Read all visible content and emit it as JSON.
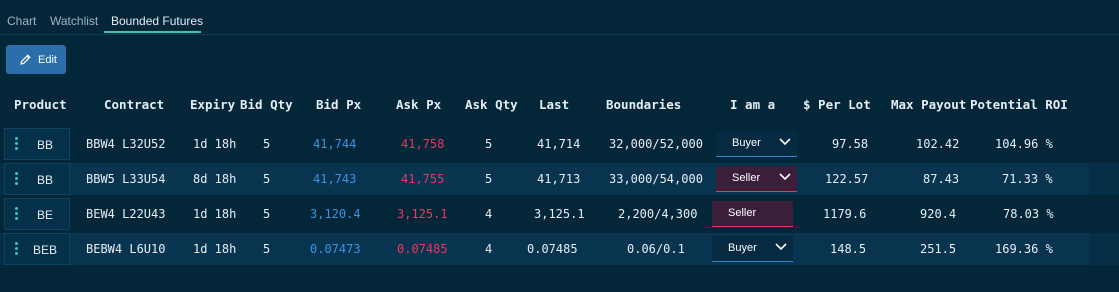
{
  "tabs": [
    {
      "label": "Chart"
    },
    {
      "label": "Watchlist"
    },
    {
      "label": "Bounded Futures"
    }
  ],
  "toolbar": {
    "edit_label": "Edit"
  },
  "columns": [
    "Product",
    "Contract",
    "Expiry",
    "Bid Qty",
    "Bid Px",
    "Ask Px",
    "Ask Qty",
    "Last",
    "Boundaries",
    "I am a",
    "$ Per Lot",
    "Max Payout",
    "Potential ROI"
  ],
  "rows": [
    {
      "product": "BB",
      "contract": "BBW4 L32U52",
      "expiry": "1d 18h",
      "bid_qty": "5",
      "bid_px": "41,744",
      "ask_px": "41,758",
      "ask_qty": "5",
      "last": "41,714",
      "boundaries": "32,000/52,000",
      "side": "Buyer",
      "per_lot": "97.58",
      "max_payout": "102.42",
      "roi": "104.96 %"
    },
    {
      "product": "BB",
      "contract": "BBW5 L33U54",
      "expiry": "8d 18h",
      "bid_qty": "5",
      "bid_px": "41,743",
      "ask_px": "41,755",
      "ask_qty": "5",
      "last": "41,713",
      "boundaries": "33,000/54,000",
      "side": "Seller",
      "per_lot": "122.57",
      "max_payout": "87.43",
      "roi": "71.33 %"
    },
    {
      "product": "BE",
      "contract": "BEW4 L22U43",
      "expiry": "1d 18h",
      "bid_qty": "5",
      "bid_px": "3,120.4",
      "ask_px": "3,125.1",
      "ask_qty": "4",
      "last": "3,125.1",
      "boundaries": "2,200/4,300",
      "side": "Seller",
      "per_lot": "1179.6",
      "max_payout": "920.4",
      "roi": "78.03 %"
    },
    {
      "product": "BEB",
      "contract": "BEBW4 L6U10",
      "expiry": "1d 18h",
      "bid_qty": "5",
      "bid_px": "0.07473",
      "ask_px": "0.07485",
      "ask_qty": "4",
      "last": "0.07485",
      "boundaries": "0.06/0.1",
      "side": "Buyer",
      "per_lot": "148.5",
      "max_payout": "251.5",
      "roi": "169.36 %"
    }
  ],
  "colors": {
    "background": "#032639",
    "bid": "#3b93e0",
    "ask": "#e8395f",
    "accent": "#36c7b3",
    "button": "#2c6eaa"
  },
  "icons": {
    "edit": "pencil-icon",
    "row_menu": "vertical-dots-icon",
    "dropdown": "chevron-down-icon"
  }
}
